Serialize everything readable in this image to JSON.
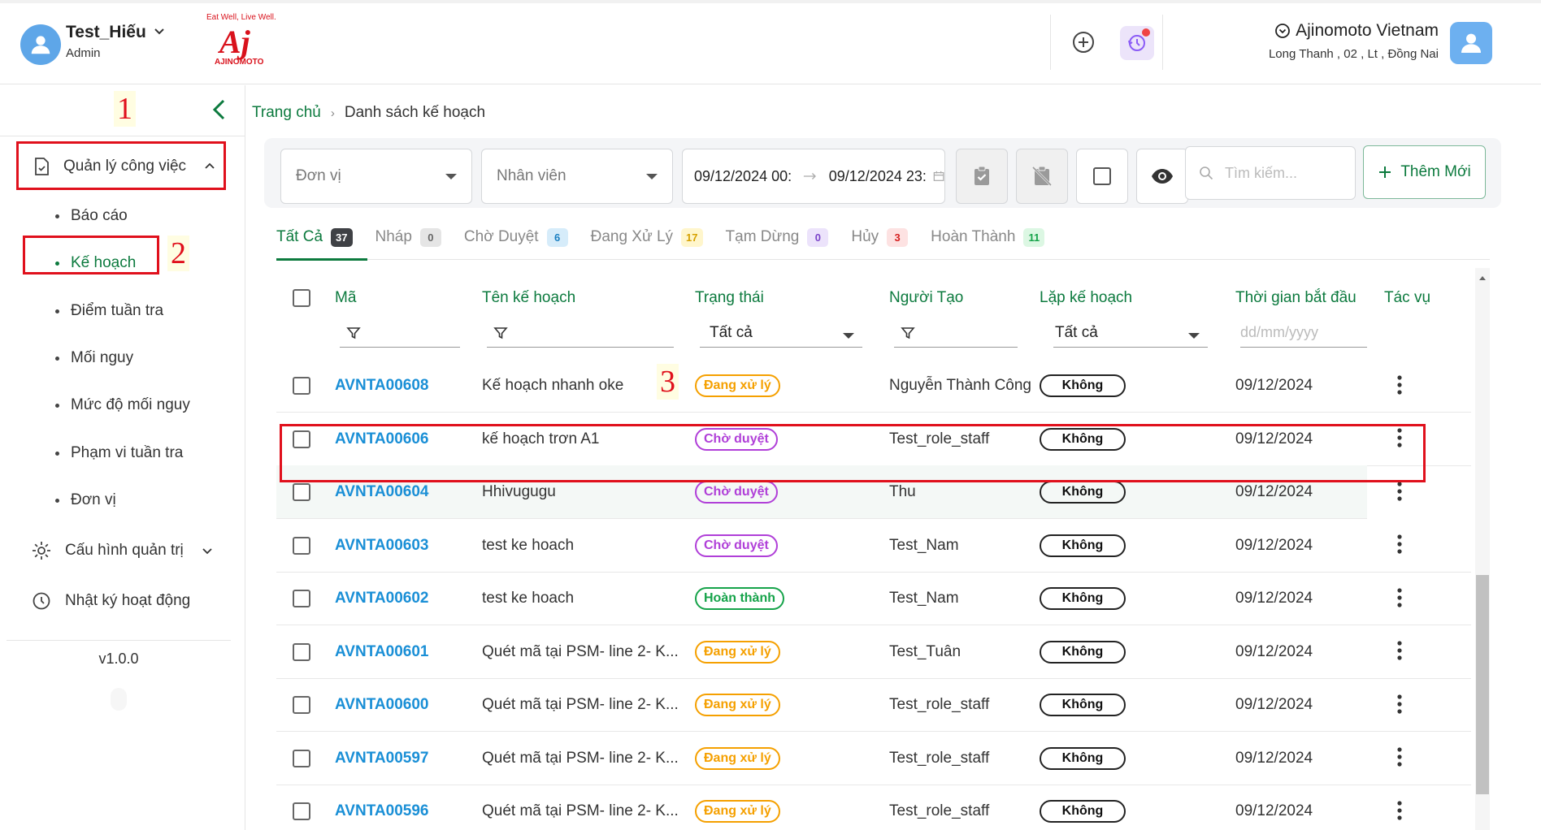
{
  "header": {
    "user_name": "Test_Hiếu",
    "user_role": "Admin",
    "brand_slogan": "Eat Well, Live Well.",
    "brand_mark": "Aj",
    "brand_name": "AJINOMOTO",
    "company_name": "Ajinomoto Vietnam",
    "company_address": "Long Thanh , 02 , Lt , Đồng Nai",
    "accent_color": "#0c7a3e"
  },
  "sidebar": {
    "groups": [
      {
        "label": "Quản lý công việc",
        "icon": "task-doc-icon"
      },
      {
        "label": "Cấu hình quản trị",
        "icon": "gear-icon"
      },
      {
        "label": "Nhật ký hoạt động",
        "icon": "history-icon"
      }
    ],
    "items": [
      {
        "label": "Báo cáo"
      },
      {
        "label": "Kế hoạch"
      },
      {
        "label": "Điểm tuần tra"
      },
      {
        "label": "Mối nguy"
      },
      {
        "label": "Mức độ mối nguy"
      },
      {
        "label": "Phạm vi tuần tra"
      },
      {
        "label": "Đơn vị"
      }
    ],
    "version": "v1.0.0"
  },
  "annotations": [
    "1",
    "2",
    "3"
  ],
  "breadcrumb": {
    "home": "Trang chủ",
    "current": "Danh sách kế hoạch"
  },
  "filters": {
    "unit_placeholder": "Đơn vị",
    "staff_placeholder": "Nhân viên",
    "date_from": "09/12/2024 00:",
    "date_to": "09/12/2024 23:",
    "search_placeholder": "Tìm kiếm...",
    "add_new_label": "Thêm Mới"
  },
  "tabs": [
    {
      "label": "Tất Cả",
      "count": "37",
      "badge_bg": "#3f4145",
      "badge_fg": "#ffffff"
    },
    {
      "label": "Nháp",
      "count": "0",
      "badge_bg": "#e5e5e5",
      "badge_fg": "#666666"
    },
    {
      "label": "Chờ Duyệt",
      "count": "6",
      "badge_bg": "#d6ecfa",
      "badge_fg": "#1a7fc1"
    },
    {
      "label": "Đang Xử Lý",
      "count": "17",
      "badge_bg": "#fff6cc",
      "badge_fg": "#d6a100"
    },
    {
      "label": "Tạm Dừng",
      "count": "0",
      "badge_bg": "#ece3fb",
      "badge_fg": "#7b44c9"
    },
    {
      "label": "Hủy",
      "count": "3",
      "badge_bg": "#fde2e2",
      "badge_fg": "#d62020"
    },
    {
      "label": "Hoàn Thành",
      "count": "11",
      "badge_bg": "#dcf7e3",
      "badge_fg": "#16a34a"
    }
  ],
  "table": {
    "columns": [
      "Mã",
      "Tên kế hoạch",
      "Trạng thái",
      "Người Tạo",
      "Lặp kế hoạch",
      "Thời gian bắt đầu",
      "Tác vụ"
    ],
    "filter_status_value": "Tất cả",
    "filter_repeat_value": "Tất cả",
    "filter_date_placeholder": "dd/mm/yyyy",
    "rows": [
      {
        "code": "AVNTA00608",
        "name": "Kế hoạch nhanh oke",
        "status": "Đang xử lý",
        "status_type": "process",
        "creator": "Nguyễn Thành Công",
        "repeat": "Không",
        "start": "09/12/2024"
      },
      {
        "code": "AVNTA00606",
        "name": "kế hoạch trơn A1",
        "status": "Chờ duyệt",
        "status_type": "pending",
        "creator": "Test_role_staff",
        "repeat": "Không",
        "start": "09/12/2024"
      },
      {
        "code": "AVNTA00604",
        "name": "Hhivugugu",
        "status": "Chờ duyệt",
        "status_type": "pending",
        "creator": "Thu",
        "repeat": "Không",
        "start": "09/12/2024"
      },
      {
        "code": "AVNTA00603",
        "name": "test ke hoach",
        "status": "Chờ duyệt",
        "status_type": "pending",
        "creator": "Test_Nam",
        "repeat": "Không",
        "start": "09/12/2024"
      },
      {
        "code": "AVNTA00602",
        "name": "test ke hoach",
        "status": "Hoàn thành",
        "status_type": "done",
        "creator": "Test_Nam",
        "repeat": "Không",
        "start": "09/12/2024"
      },
      {
        "code": "AVNTA00601",
        "name": "Quét mã tại PSM- line 2- K...",
        "status": "Đang xử lý",
        "status_type": "process",
        "creator": "Test_Tuân",
        "repeat": "Không",
        "start": "09/12/2024"
      },
      {
        "code": "AVNTA00600",
        "name": "Quét mã tại PSM- line 2- K...",
        "status": "Đang xử lý",
        "status_type": "process",
        "creator": "Test_role_staff",
        "repeat": "Không",
        "start": "09/12/2024"
      },
      {
        "code": "AVNTA00597",
        "name": "Quét mã tại PSM- line 2- K...",
        "status": "Đang xử lý",
        "status_type": "process",
        "creator": "Test_role_staff",
        "repeat": "Không",
        "start": "09/12/2024"
      },
      {
        "code": "AVNTA00596",
        "name": "Quét mã tại PSM- line 2- K...",
        "status": "Đang xử lý",
        "status_type": "process",
        "creator": "Test_role_staff",
        "repeat": "Không",
        "start": "09/12/2024"
      }
    ]
  }
}
